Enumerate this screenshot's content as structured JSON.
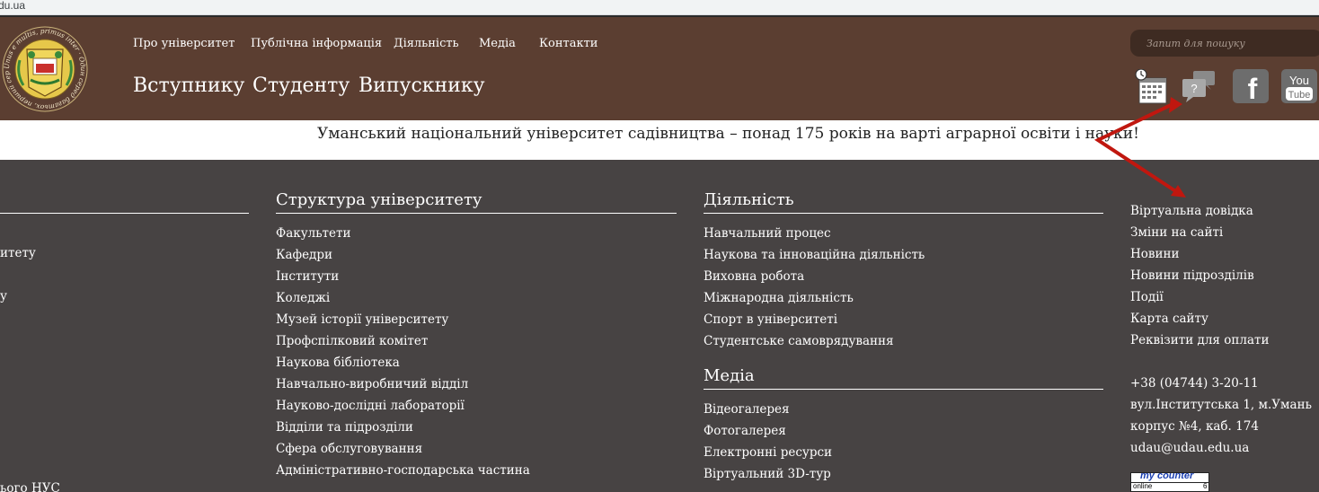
{
  "browser": {
    "url_fragment": "du.ua"
  },
  "logo": {
    "ring_text": "Unus e multis, primus inter · Один серед багатьох, перший серед усіх"
  },
  "top_nav": [
    "Про університет",
    "Публічна інформація",
    "Діяльність",
    "Медіа",
    "Контакти"
  ],
  "main_nav": [
    "Вступнику",
    "Студенту",
    "Випускнику"
  ],
  "search": {
    "placeholder": "Запит для пошуку"
  },
  "social": {
    "facebook": "f",
    "youtube_top": "You",
    "youtube_bottom": "Tube",
    "help": "?"
  },
  "slogan": "Уманський національний університет садівництва – понад 175 років на варті аграрної освіти і науки!",
  "left_fragments": [
    "итету",
    "у",
    "ього НУС"
  ],
  "structure": {
    "title": "Структура університету",
    "items": [
      "Факультети",
      "Кафедри",
      "Інститути",
      "Коледжі",
      "Музей історії університету",
      "Профспілковий комітет",
      "Наукова бібліотека",
      "Навчально-виробничий відділ",
      "Науково-дослідні лабораторії",
      "Відділи та підрозділи",
      "Сфера обслуговування",
      "Адміністративно-господарська частина"
    ]
  },
  "activity": {
    "title": "Діяльність",
    "items": [
      "Навчальний процес",
      "Наукова та інноваційна діяльність",
      "Виховна робота",
      "Міжнародна діяльність",
      "Спорт в університеті",
      "Студентське самоврядування"
    ]
  },
  "media": {
    "title": "Медіа",
    "items": [
      "Відеогалерея",
      "Фотогалерея",
      "Електронні ресурси",
      "Віртуальний 3D-тур"
    ]
  },
  "quick_links": [
    "Віртуальна довідка",
    "Зміни на сайті",
    "Новини",
    "Новини підрозділів",
    "Події",
    "Карта сайту",
    "Реквізити для оплати"
  ],
  "contacts": [
    "+38 (04744) 3-20-11",
    "вул.Інститутська 1, м.Умань",
    "корпус №4, каб. 174",
    "udau@udau.edu.ua"
  ],
  "counter": {
    "top": "my counter",
    "label": "online",
    "value": "6"
  },
  "colors": {
    "header": "#5b3e31",
    "footer": "#474343",
    "arrow": "#c0170f"
  }
}
